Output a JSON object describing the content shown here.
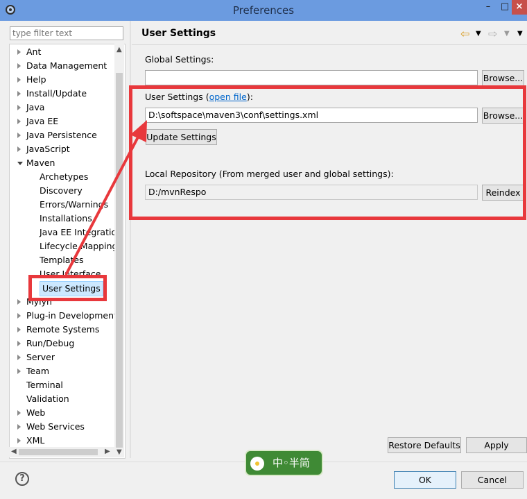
{
  "window": {
    "title": "Preferences",
    "minimize": "–",
    "maximize": "□",
    "close": "×"
  },
  "filter": {
    "placeholder": "type filter text"
  },
  "tree": [
    {
      "label": "Ant",
      "level": 0,
      "twist": "closed"
    },
    {
      "label": "Data Management",
      "level": 0,
      "twist": "closed"
    },
    {
      "label": "Help",
      "level": 0,
      "twist": "closed"
    },
    {
      "label": "Install/Update",
      "level": 0,
      "twist": "closed"
    },
    {
      "label": "Java",
      "level": 0,
      "twist": "closed"
    },
    {
      "label": "Java EE",
      "level": 0,
      "twist": "closed"
    },
    {
      "label": "Java Persistence",
      "level": 0,
      "twist": "closed"
    },
    {
      "label": "JavaScript",
      "level": 0,
      "twist": "closed"
    },
    {
      "label": "Maven",
      "level": 0,
      "twist": "open"
    },
    {
      "label": "Archetypes",
      "level": 1,
      "twist": ""
    },
    {
      "label": "Discovery",
      "level": 1,
      "twist": ""
    },
    {
      "label": "Errors/Warnings",
      "level": 1,
      "twist": ""
    },
    {
      "label": "Installations",
      "level": 1,
      "twist": ""
    },
    {
      "label": "Java EE Integration",
      "level": 1,
      "twist": ""
    },
    {
      "label": "Lifecycle Mapping",
      "level": 1,
      "twist": ""
    },
    {
      "label": "Templates",
      "level": 1,
      "twist": ""
    },
    {
      "label": "User Interface",
      "level": 1,
      "twist": ""
    },
    {
      "label": "User Settings",
      "level": 1,
      "twist": "",
      "selected": true
    },
    {
      "label": "Mylyn",
      "level": 0,
      "twist": "closed"
    },
    {
      "label": "Plug-in Development",
      "level": 0,
      "twist": "closed"
    },
    {
      "label": "Remote Systems",
      "level": 0,
      "twist": "closed"
    },
    {
      "label": "Run/Debug",
      "level": 0,
      "twist": "closed"
    },
    {
      "label": "Server",
      "level": 0,
      "twist": "closed"
    },
    {
      "label": "Team",
      "level": 0,
      "twist": "closed"
    },
    {
      "label": "Terminal",
      "level": 0,
      "twist": ""
    },
    {
      "label": "Validation",
      "level": 0,
      "twist": ""
    },
    {
      "label": "Web",
      "level": 0,
      "twist": "closed"
    },
    {
      "label": "Web Services",
      "level": 0,
      "twist": "closed"
    },
    {
      "label": "XML",
      "level": 0,
      "twist": "closed"
    }
  ],
  "page": {
    "title": "User Settings",
    "global_label": "Global Settings:",
    "global_value": "",
    "user_label_prefix": "User Settings (",
    "user_link": "open file",
    "user_label_suffix": "):",
    "user_value": "D:\\softspace\\maven3\\conf\\settings.xml",
    "browse": "Browse...",
    "update": "Update Settings",
    "repo_label": "Local Repository (From merged user and global settings):",
    "repo_value": "D:/mvnRespo",
    "reindex": "Reindex"
  },
  "footer": {
    "restore": "Restore Defaults",
    "apply": "Apply",
    "ok": "OK",
    "cancel": "Cancel"
  },
  "watermark": {
    "text": "中◦半简"
  },
  "colors": {
    "highlight_box": "#e8383c",
    "titlebar": "#6b9be0",
    "selection": "#cce8ff"
  }
}
